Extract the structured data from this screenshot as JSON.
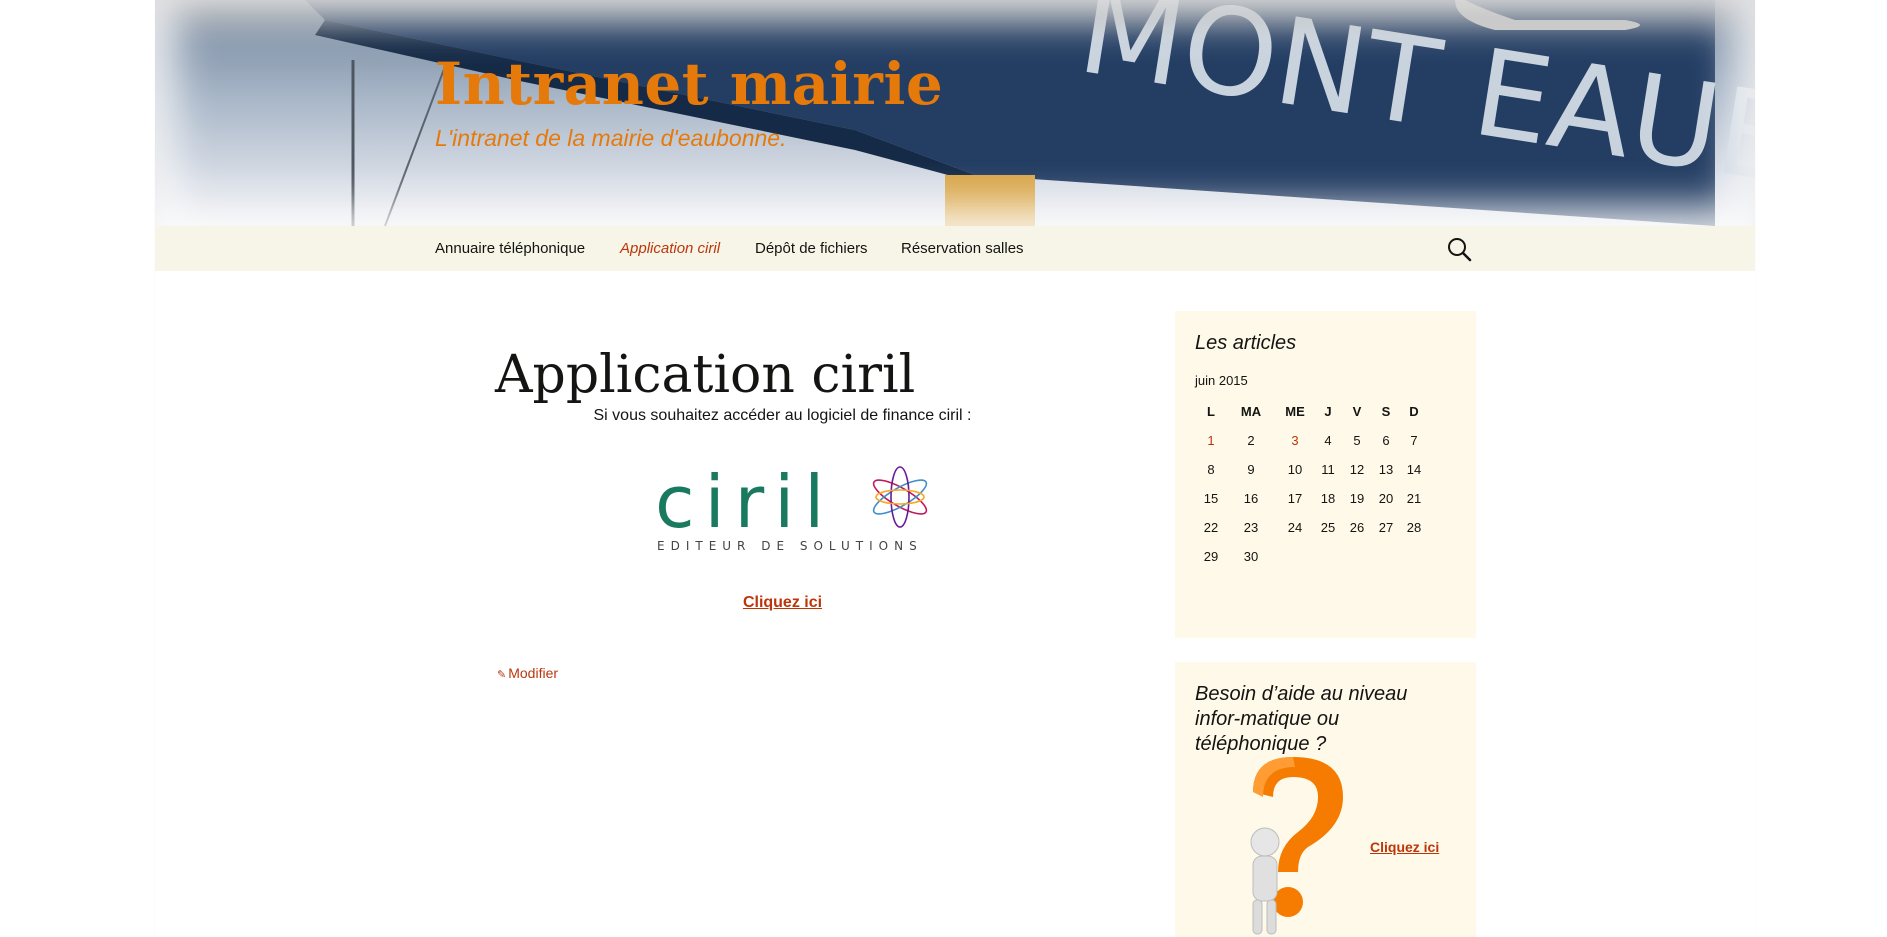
{
  "header": {
    "site_title": "Intranet mairie",
    "site_description": "L'intranet de la mairie d'eaubonne.",
    "banner_sign_text": "MONT EAUBONNE"
  },
  "nav": {
    "items": [
      {
        "label": "Annuaire téléphonique",
        "active": false
      },
      {
        "label": "Application ciril",
        "active": true
      },
      {
        "label": "Dépôt de fichiers",
        "active": false
      },
      {
        "label": "Réservation salles",
        "active": false
      }
    ],
    "search_icon": "search-icon"
  },
  "content": {
    "title": "Application ciril",
    "intro": "Si vous souhaitez accéder au logiciel de finance ciril :",
    "logo": {
      "wordmark": "ciril",
      "tagline": "EDITEUR DE SOLUTIONS"
    },
    "link_label": "Cliquez ici",
    "edit_label": "Modifier",
    "edit_icon": "pencil-icon"
  },
  "sidebar": {
    "calendar_widget": {
      "title": "Les articles",
      "caption": "juin 2015",
      "weekdays": [
        "L",
        "MA",
        "ME",
        "J",
        "V",
        "S",
        "D"
      ],
      "weeks": [
        [
          "1",
          "2",
          "3",
          "4",
          "5",
          "6",
          "7"
        ],
        [
          "8",
          "9",
          "10",
          "11",
          "12",
          "13",
          "14"
        ],
        [
          "15",
          "16",
          "17",
          "18",
          "19",
          "20",
          "21"
        ],
        [
          "22",
          "23",
          "24",
          "25",
          "26",
          "27",
          "28"
        ],
        [
          "29",
          "30",
          "",
          "",
          "",
          "",
          ""
        ]
      ],
      "linked_days": [
        "1",
        "3"
      ]
    },
    "help_widget": {
      "title": "Besoin d’aide au niveau infor-matique ou téléphonique ?",
      "link_label": "Cliquez ici",
      "image_icon": "question-mark-figure-icon"
    }
  },
  "colors": {
    "accent": "#bc360a",
    "title_orange": "#e57a0b",
    "nav_bg": "#f7f5e7",
    "widget_bg": "#fef9e8"
  }
}
